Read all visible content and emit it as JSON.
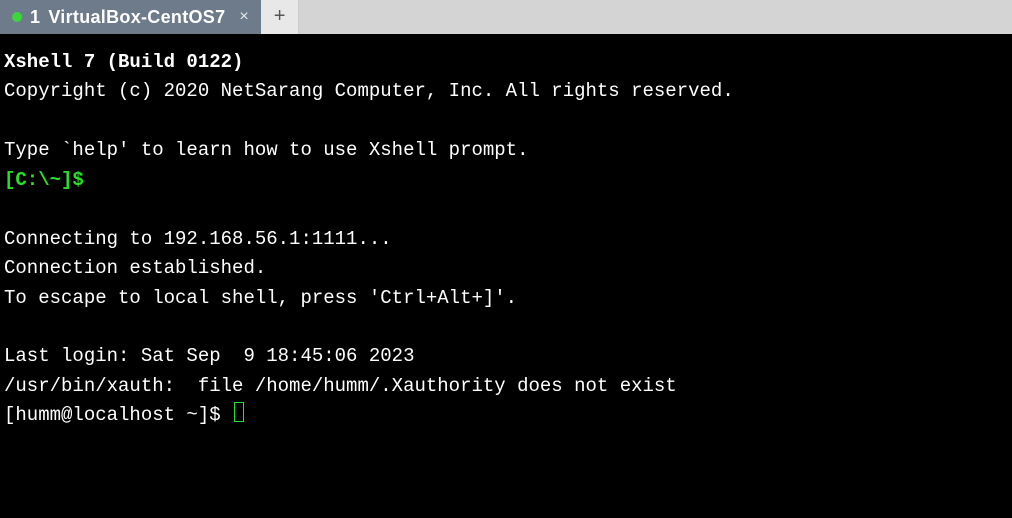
{
  "tabbar": {
    "tab": {
      "index": "1",
      "title": "VirtualBox-CentOS7",
      "close": "×"
    },
    "newtab": "+"
  },
  "terminal": {
    "banner_title": "Xshell 7 (Build 0122)",
    "copyright": "Copyright (c) 2020 NetSarang Computer, Inc. All rights reserved.",
    "help_hint": "Type `help' to learn how to use Xshell prompt.",
    "local_prompt": "[C:\\~]$",
    "connecting": "Connecting to 192.168.56.1:1111...",
    "established": "Connection established.",
    "escape_hint": "To escape to local shell, press 'Ctrl+Alt+]'.",
    "last_login": "Last login: Sat Sep  9 18:45:06 2023",
    "xauth_line": "/usr/bin/xauth:  file /home/humm/.Xauthority does not exist",
    "shell_prompt": "[humm@localhost ~]$ "
  }
}
